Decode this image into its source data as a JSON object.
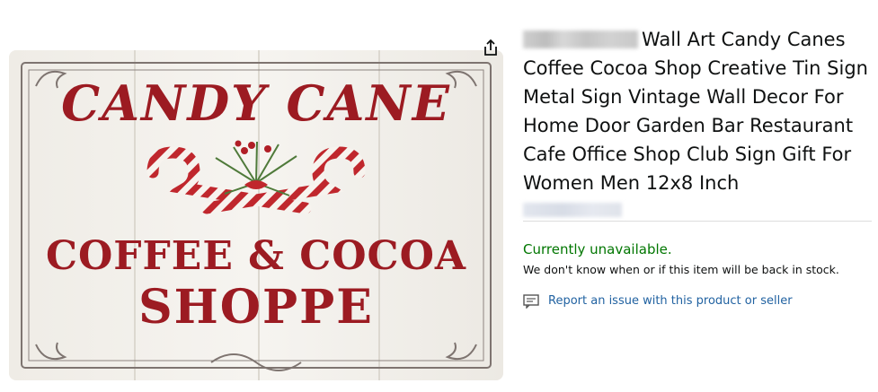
{
  "product": {
    "title": "Wall Art Candy Canes Coffee Cocoa Shop Creative Tin Sign Metal Sign Vintage Wall Decor For Home Door Garden Bar Restaurant Cafe Office Shop Club Sign Gift For Women Men 12x8 Inch",
    "availability": "Currently unavailable.",
    "stock_note": "We don't know when or if this item will be back in stock.",
    "report_link": "Report an issue with this product or seller"
  },
  "sign": {
    "line1": "CANDY CANE",
    "line2": "COFFEE & COCOA",
    "line3": "SHOPPE"
  },
  "icons": {
    "share": "share-icon",
    "report": "message-report-icon"
  },
  "colors": {
    "availability": "#007600",
    "link": "#2162a1",
    "sign_text": "#9c1b22"
  }
}
